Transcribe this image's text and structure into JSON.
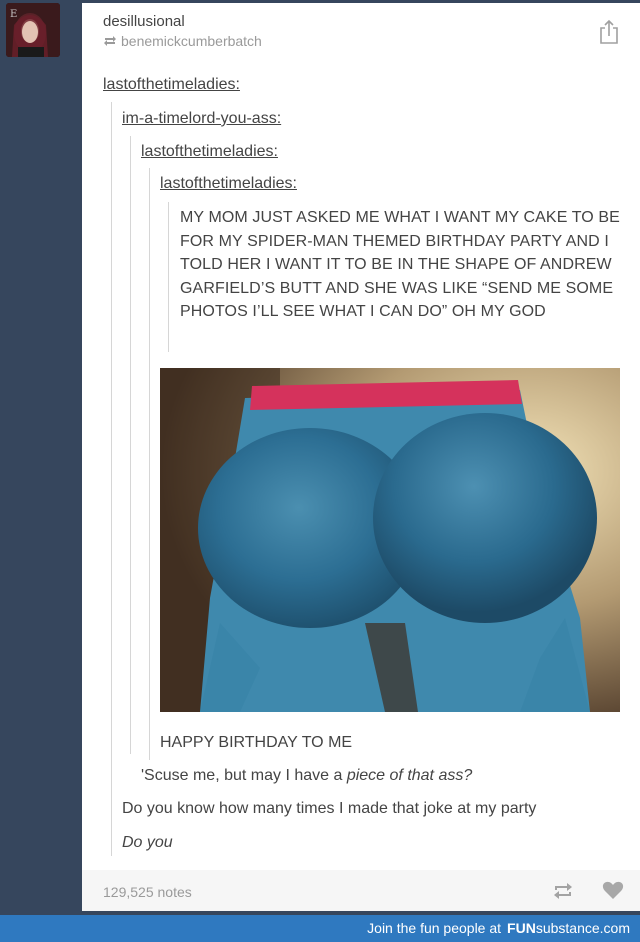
{
  "post": {
    "blog_name": "desillusional",
    "reblogged_from": "benemickcumberbatch",
    "trail": [
      {
        "user": "lastofthetimeladies:"
      },
      {
        "user": "im-a-timelord-you-ass:"
      },
      {
        "user": "lastofthetimeladies:"
      },
      {
        "user": "lastofthetimeladies:"
      }
    ],
    "quote": "MY MOM JUST ASKED ME WHAT I WANT MY CAKE TO BE FOR MY SPIDER-MAN THEMED BIRTHDAY PARTY AND I TOLD HER I WANT IT TO BE IN THE SHAPE OF ANDREW GARFIELD’S BUTT AND SHE WAS LIKE “SEND ME SOME PHOTOS I’LL SEE WHAT I CAN DO” OH MY GOD",
    "caption": "HAPPY BIRTHDAY TO ME",
    "reply1_prefix": "'Scuse me, but may I have a ",
    "reply1_italic": "piece of that ass?",
    "reply2": "Do you know how many times I made that joke at my party",
    "reply3": "Do you",
    "notes": "129,525 notes"
  },
  "icons": [
    "reblog-icon",
    "share-icon",
    "heart-icon"
  ],
  "colors": {
    "background": "#36465d",
    "brand_bar": "#2f79c0"
  },
  "brand": {
    "promo": "Join the fun people at",
    "logo_bold": "FUN",
    "logo_rest": "substance.com"
  }
}
